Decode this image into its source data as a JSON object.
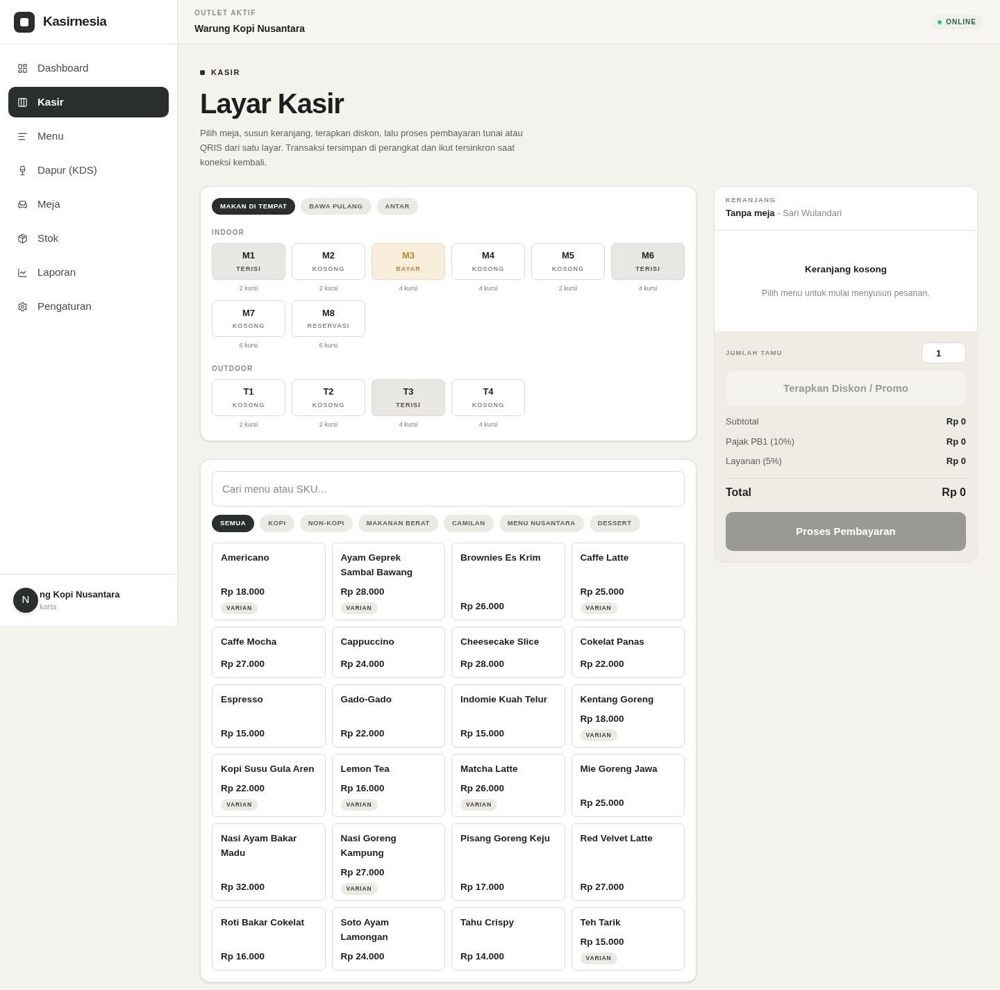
{
  "brand": {
    "name": "Kasirnesia"
  },
  "sidebar": {
    "items": [
      {
        "label": "Dashboard",
        "selected": false
      },
      {
        "label": "Kasir",
        "selected": true
      },
      {
        "label": "Menu",
        "selected": false
      },
      {
        "label": "Dapur (KDS)",
        "selected": false
      },
      {
        "label": "Meja",
        "selected": false
      },
      {
        "label": "Stok",
        "selected": false
      },
      {
        "label": "Laporan",
        "selected": false
      },
      {
        "label": "Pengaturan",
        "selected": false
      }
    ],
    "footer": {
      "name": "ng Kopi Nusantara",
      "city": "karta",
      "badge": "N"
    }
  },
  "header": {
    "label": "OUTLET AKTIF",
    "outlet": "Warung Kopi Nusantara",
    "status": "ONLINE",
    "online": true
  },
  "page": {
    "eyebrow": "KASIR",
    "title": "Layar Kasir",
    "description": "Pilih meja, susun keranjang, terapkan diskon, lalu proses pembayaran tunai atau QRIS dari satu layar. Transaksi tersimpan di perangkat dan ikut tersinkron saat koneksi kembali."
  },
  "order_types": [
    {
      "label": "MAKAN DI TEMPAT",
      "selected": true
    },
    {
      "label": "BAWA PULANG",
      "selected": false
    },
    {
      "label": "ANTAR",
      "selected": false
    }
  ],
  "areas": [
    {
      "name": "INDOOR",
      "tables": [
        {
          "code": "M1",
          "status": "TERISI",
          "kind": "occupied",
          "seats": "2 kursi"
        },
        {
          "code": "M2",
          "status": "KOSONG",
          "kind": "empty",
          "seats": "2 kursi"
        },
        {
          "code": "M3",
          "status": "BAYAR",
          "kind": "paying",
          "seats": "4 kursi"
        },
        {
          "code": "M4",
          "status": "KOSONG",
          "kind": "empty",
          "seats": "4 kursi"
        },
        {
          "code": "M5",
          "status": "KOSONG",
          "kind": "empty",
          "seats": "2 kursi"
        },
        {
          "code": "M6",
          "status": "TERISI",
          "kind": "occupied",
          "seats": "4 kursi"
        },
        {
          "code": "M7",
          "status": "KOSONG",
          "kind": "empty",
          "seats": "6 kursi"
        },
        {
          "code": "M8",
          "status": "RESERVASI",
          "kind": "reserved",
          "seats": "6 kursi"
        }
      ]
    },
    {
      "name": "OUTDOOR",
      "tables": [
        {
          "code": "T1",
          "status": "KOSONG",
          "kind": "empty",
          "seats": "2 kursi"
        },
        {
          "code": "T2",
          "status": "KOSONG",
          "kind": "empty",
          "seats": "2 kursi"
        },
        {
          "code": "T3",
          "status": "TERISI",
          "kind": "occupied",
          "seats": "4 kursi"
        },
        {
          "code": "T4",
          "status": "KOSONG",
          "kind": "empty",
          "seats": "4 kursi"
        }
      ]
    }
  ],
  "search": {
    "placeholder": "Cari menu atau SKU..."
  },
  "categories": [
    {
      "label": "SEMUA",
      "selected": true
    },
    {
      "label": "KOPI",
      "selected": false
    },
    {
      "label": "NON-KOPI",
      "selected": false
    },
    {
      "label": "MAKANAN BERAT",
      "selected": false
    },
    {
      "label": "CAMILAN",
      "selected": false
    },
    {
      "label": "MENU NUSANTARA",
      "selected": false
    },
    {
      "label": "DESSERT",
      "selected": false
    }
  ],
  "menu_items": [
    {
      "name": "Americano",
      "price": "Rp 18.000",
      "badge": "VARIAN"
    },
    {
      "name": "Ayam Geprek Sambal Bawang",
      "price": "Rp 28.000",
      "badge": "VARIAN"
    },
    {
      "name": "Brownies Es Krim",
      "price": "Rp 26.000"
    },
    {
      "name": "Caffe Latte",
      "price": "Rp 25.000",
      "badge": "VARIAN"
    },
    {
      "name": "Caffe Mocha",
      "price": "Rp 27.000"
    },
    {
      "name": "Cappuccino",
      "price": "Rp 24.000"
    },
    {
      "name": "Cheesecake Slice",
      "price": "Rp 28.000"
    },
    {
      "name": "Cokelat Panas",
      "price": "Rp 22.000"
    },
    {
      "name": "Espresso",
      "price": "Rp 15.000"
    },
    {
      "name": "Gado-Gado",
      "price": "Rp 22.000"
    },
    {
      "name": "Indomie Kuah Telur",
      "price": "Rp 15.000"
    },
    {
      "name": "Kentang Goreng",
      "price": "Rp 18.000",
      "badge": "VARIAN"
    },
    {
      "name": "Kopi Susu Gula Aren",
      "price": "Rp 22.000",
      "badge": "VARIAN"
    },
    {
      "name": "Lemon Tea",
      "price": "Rp 16.000",
      "badge": "VARIAN"
    },
    {
      "name": "Matcha Latte",
      "price": "Rp 26.000",
      "badge": "VARIAN"
    },
    {
      "name": "Mie Goreng Jawa",
      "price": "Rp 25.000"
    },
    {
      "name": "Nasi Ayam Bakar Madu",
      "price": "Rp 32.000"
    },
    {
      "name": "Nasi Goreng Kampung",
      "price": "Rp 27.000",
      "badge": "VARIAN"
    },
    {
      "name": "Pisang Goreng Keju",
      "price": "Rp 17.000"
    },
    {
      "name": "Red Velvet Latte",
      "price": "Rp 27.000"
    },
    {
      "name": "Roti Bakar Cokelat",
      "price": "Rp 16.000"
    },
    {
      "name": "Soto Ayam Lamongan",
      "price": "Rp 24.000"
    },
    {
      "name": "Tahu Crispy",
      "price": "Rp 14.000"
    },
    {
      "name": "Teh Tarik",
      "price": "Rp 15.000",
      "badge": "VARIAN"
    }
  ],
  "cart": {
    "label": "KERANJANG",
    "table": "Tanpa meja",
    "separator": "-",
    "customer": "Sari Wulandari",
    "empty_title": "Keranjang kosong",
    "empty_text": "Pilih menu untuk mulai menyusun pesanan.",
    "guests_label": "JUMLAH TAMU",
    "guests_value": "1",
    "discount_button": {
      "label": "Terapkan Diskon / Promo",
      "disabled": true
    },
    "lines": [
      {
        "label": "Subtotal",
        "value": "Rp 0"
      },
      {
        "label": "Pajak PB1 (10%)",
        "value": "Rp 0"
      },
      {
        "label": "Layanan (5%)",
        "value": "Rp 0"
      }
    ],
    "total": {
      "label": "Total",
      "value": "Rp 0"
    },
    "pay_button": {
      "label": "Proses Pembayaran",
      "disabled": true
    }
  }
}
